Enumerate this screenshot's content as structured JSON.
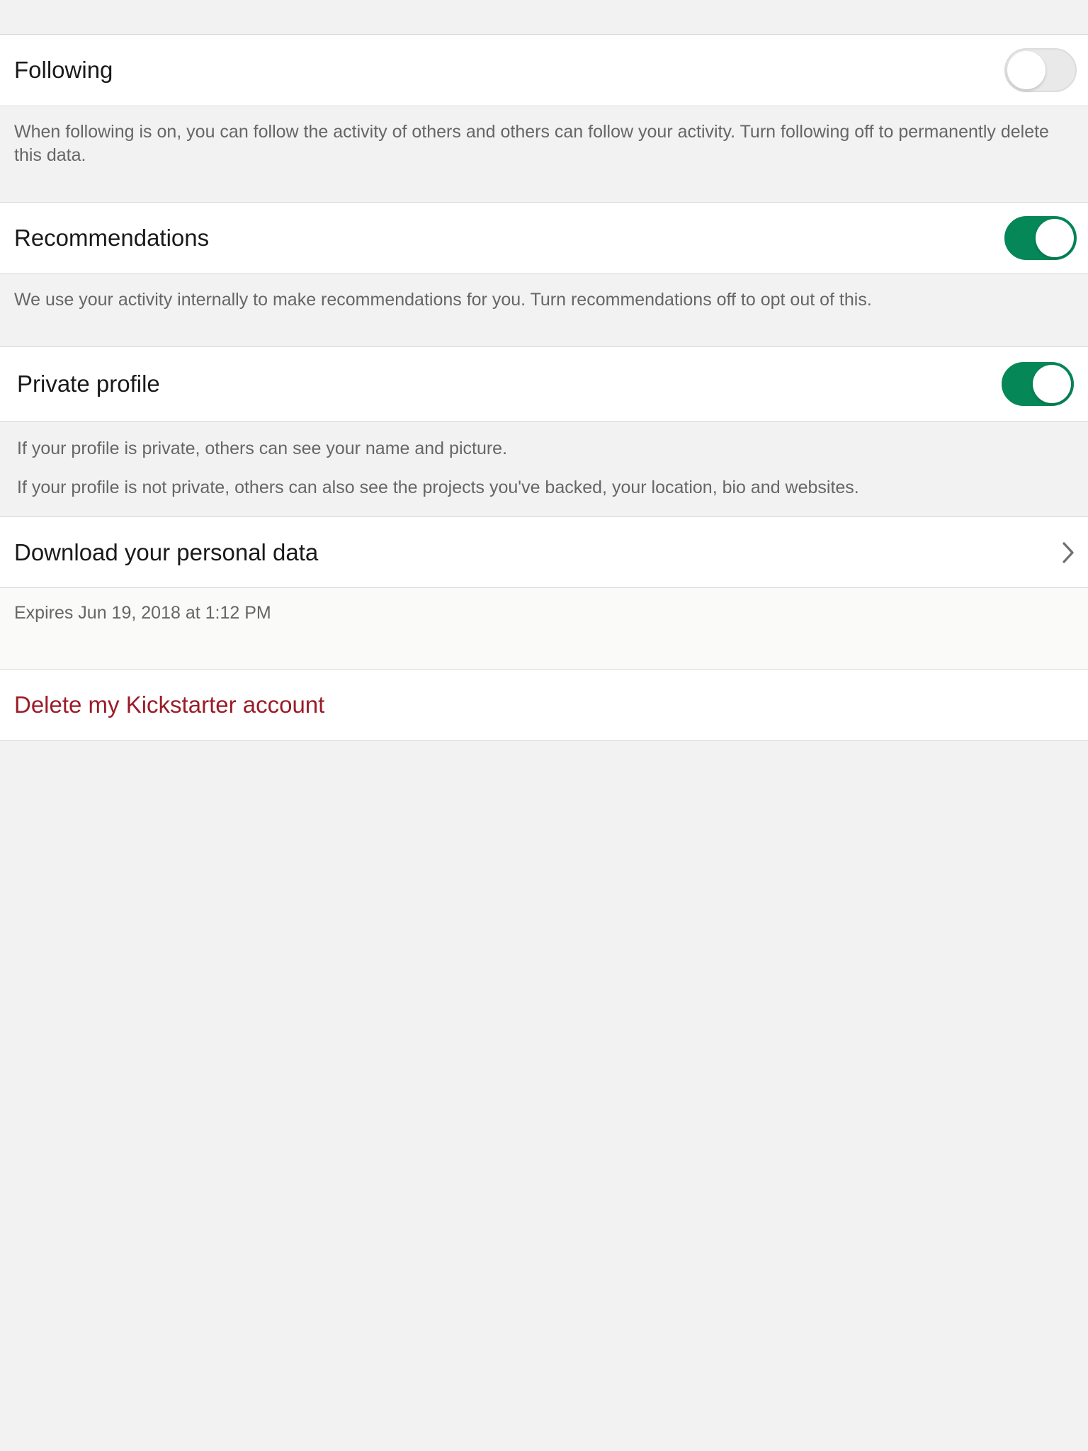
{
  "colors": {
    "background": "#f2f2f2",
    "toggle_on": "#058758",
    "toggle_off": "#e9e9ea",
    "danger": "#9b1c28"
  },
  "following": {
    "label": "Following",
    "enabled": false,
    "description": "When following is on, you can follow the activity of others and others can follow your activity. Turn following off to permanently delete this data."
  },
  "recommendations": {
    "label": "Recommendations",
    "enabled": true,
    "description": "We use your activity internally to make recommendations for you. Turn recommendations off to opt out of this."
  },
  "private_profile": {
    "label": "Private profile",
    "enabled": true,
    "description_private": "If your profile is private, others can see your name and picture.",
    "description_public": "If your profile is not private, others can also see the projects you've backed, your location, bio and websites."
  },
  "download_data": {
    "label": "Download your personal data",
    "icon": "chevron-right-icon",
    "expires": "Expires Jun 19, 2018 at 1:12 PM"
  },
  "delete_account": {
    "label": "Delete my Kickstarter account"
  }
}
